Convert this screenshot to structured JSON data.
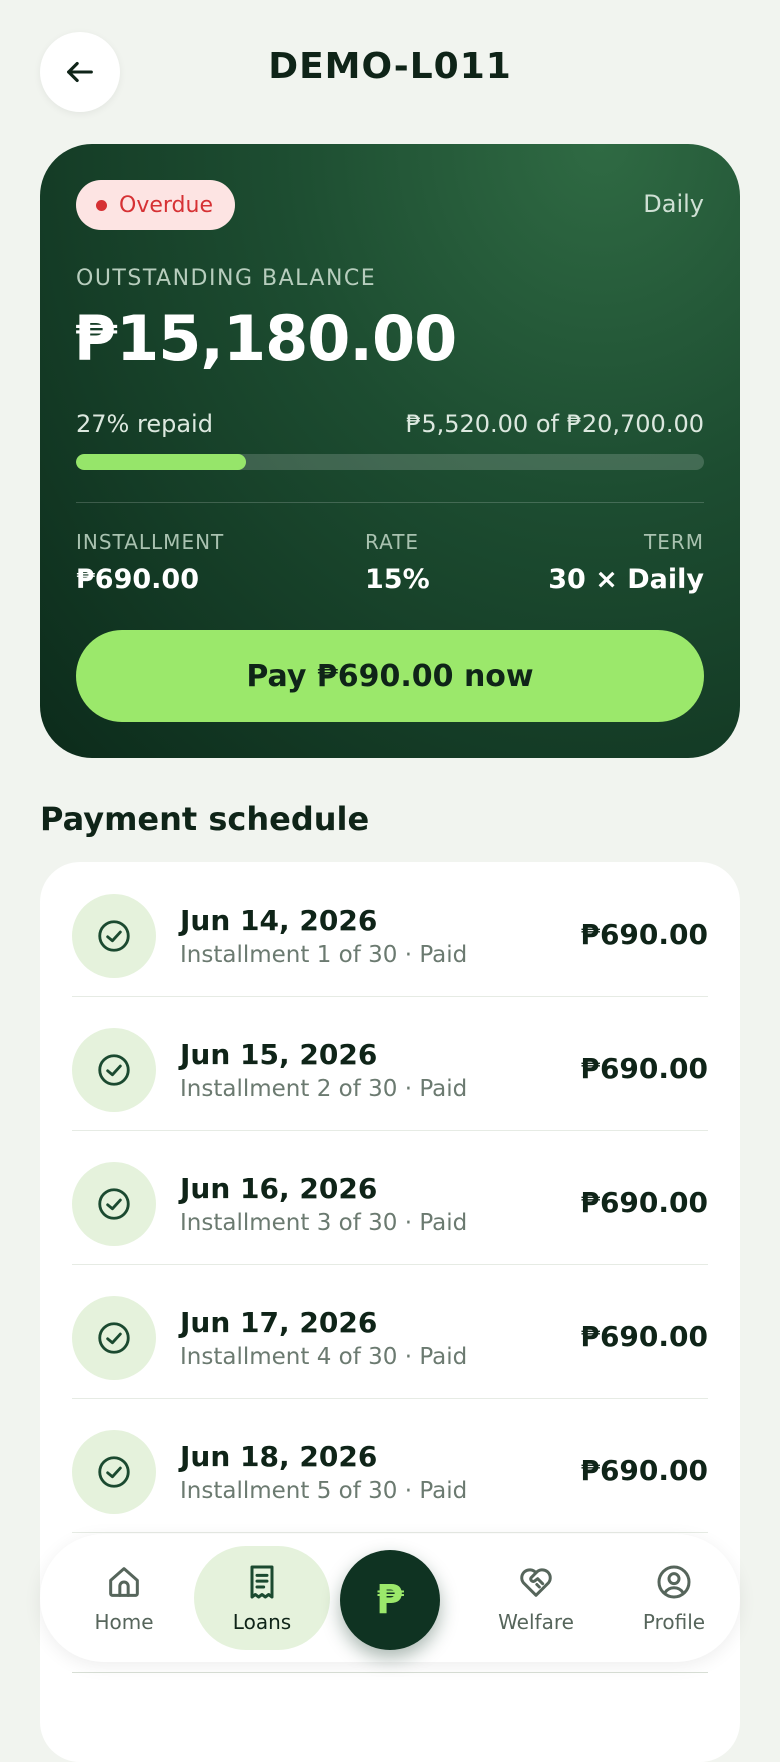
{
  "header": {
    "title": "DEMO-L011",
    "back_icon": "arrow-left-icon"
  },
  "loan": {
    "status": "Overdue",
    "status_color": "#d63134",
    "frequency": "Daily",
    "balance_label": "OUTSTANDING BALANCE",
    "balance": "₱15,180.00",
    "repaid_pct_text": "27% repaid",
    "repaid_amount_text": "₱5,520.00 of ₱20,700.00",
    "progress_fraction": 0.27,
    "installment_label": "INSTALLMENT",
    "installment_value": "₱690.00",
    "rate_label": "RATE",
    "rate_value": "15%",
    "term_label": "TERM",
    "term_value": "30 × Daily",
    "pay_button": "Pay ₱690.00 now",
    "accent_color": "#9be86b"
  },
  "schedule": {
    "title": "Payment schedule",
    "items": [
      {
        "date": "Jun 14, 2026",
        "detail": "Installment 1 of 30 · Paid",
        "amount": "₱690.00",
        "icon": "check-circle-icon"
      },
      {
        "date": "Jun 15, 2026",
        "detail": "Installment 2 of 30 · Paid",
        "amount": "₱690.00",
        "icon": "check-circle-icon"
      },
      {
        "date": "Jun 16, 2026",
        "detail": "Installment 3 of 30 · Paid",
        "amount": "₱690.00",
        "icon": "check-circle-icon"
      },
      {
        "date": "Jun 17, 2026",
        "detail": "Installment 4 of 30 · Paid",
        "amount": "₱690.00",
        "icon": "check-circle-icon"
      },
      {
        "date": "Jun 18, 2026",
        "detail": "Installment 5 of 30 · Paid",
        "amount": "₱690.00",
        "icon": "check-circle-icon"
      }
    ]
  },
  "nav": {
    "home": "Home",
    "loans": "Loans",
    "center_symbol": "₱",
    "welfare": "Welfare",
    "profile": "Profile",
    "active": "Loans"
  }
}
